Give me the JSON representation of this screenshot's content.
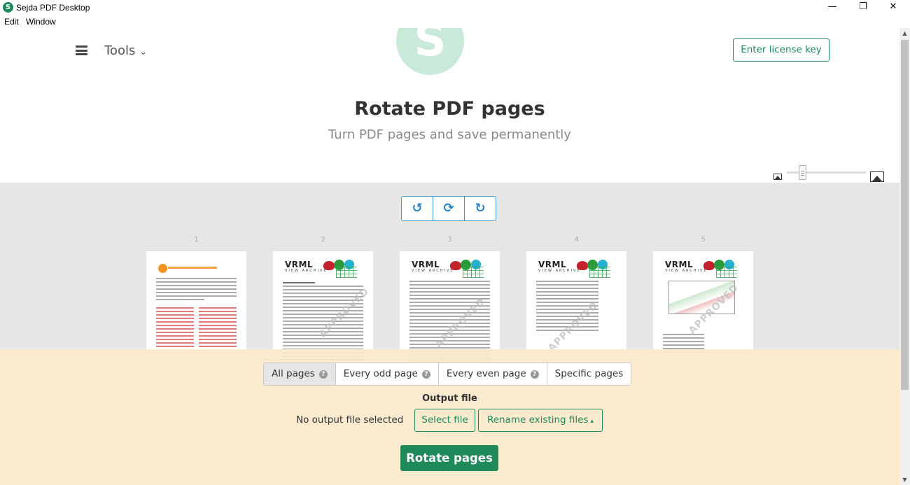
{
  "window": {
    "title": "Sejda PDF Desktop",
    "icon_letter": "S",
    "minimize": "—",
    "restore": "❐",
    "close": "✕"
  },
  "menubar": {
    "items": [
      "Edit",
      "Window"
    ]
  },
  "header": {
    "tools_label": "Tools",
    "tools_caret": "⌄",
    "logo_letter": "S",
    "license_button": "Enter license key"
  },
  "main": {
    "title": "Rotate PDF pages",
    "subtitle": "Turn PDF pages and save permanently"
  },
  "rotate_controls": {
    "left": "↺",
    "both": "⟳",
    "right": "↻"
  },
  "pages": [
    {
      "number": "1",
      "kind": "intro"
    },
    {
      "number": "2",
      "kind": "vrml",
      "stamp": "APPROVED"
    },
    {
      "number": "3",
      "kind": "vrml",
      "stamp": "APPROVED"
    },
    {
      "number": "4",
      "kind": "vrml",
      "stamp": "APPROVED"
    },
    {
      "number": "5",
      "kind": "vrml",
      "stamp": "APPROVED"
    }
  ],
  "thumb_text": {
    "vrml_logo": "VRML",
    "vrml_sub": "VIEW ARCHIVE"
  },
  "page_filter": {
    "options": [
      "All pages",
      "Every odd page",
      "Every even page",
      "Specific pages"
    ],
    "selected": "All pages",
    "help_glyph": "?"
  },
  "output": {
    "label": "Output file",
    "status": "No output file selected",
    "select_file": "Select file",
    "rename": "Rename existing files",
    "rename_caret": "▴"
  },
  "action": {
    "rotate_button": "Rotate pages"
  },
  "colors": {
    "accent_green": "#1e8a5a",
    "accent_blue": "#2a84c8",
    "panel_bg": "#fae8ca"
  }
}
